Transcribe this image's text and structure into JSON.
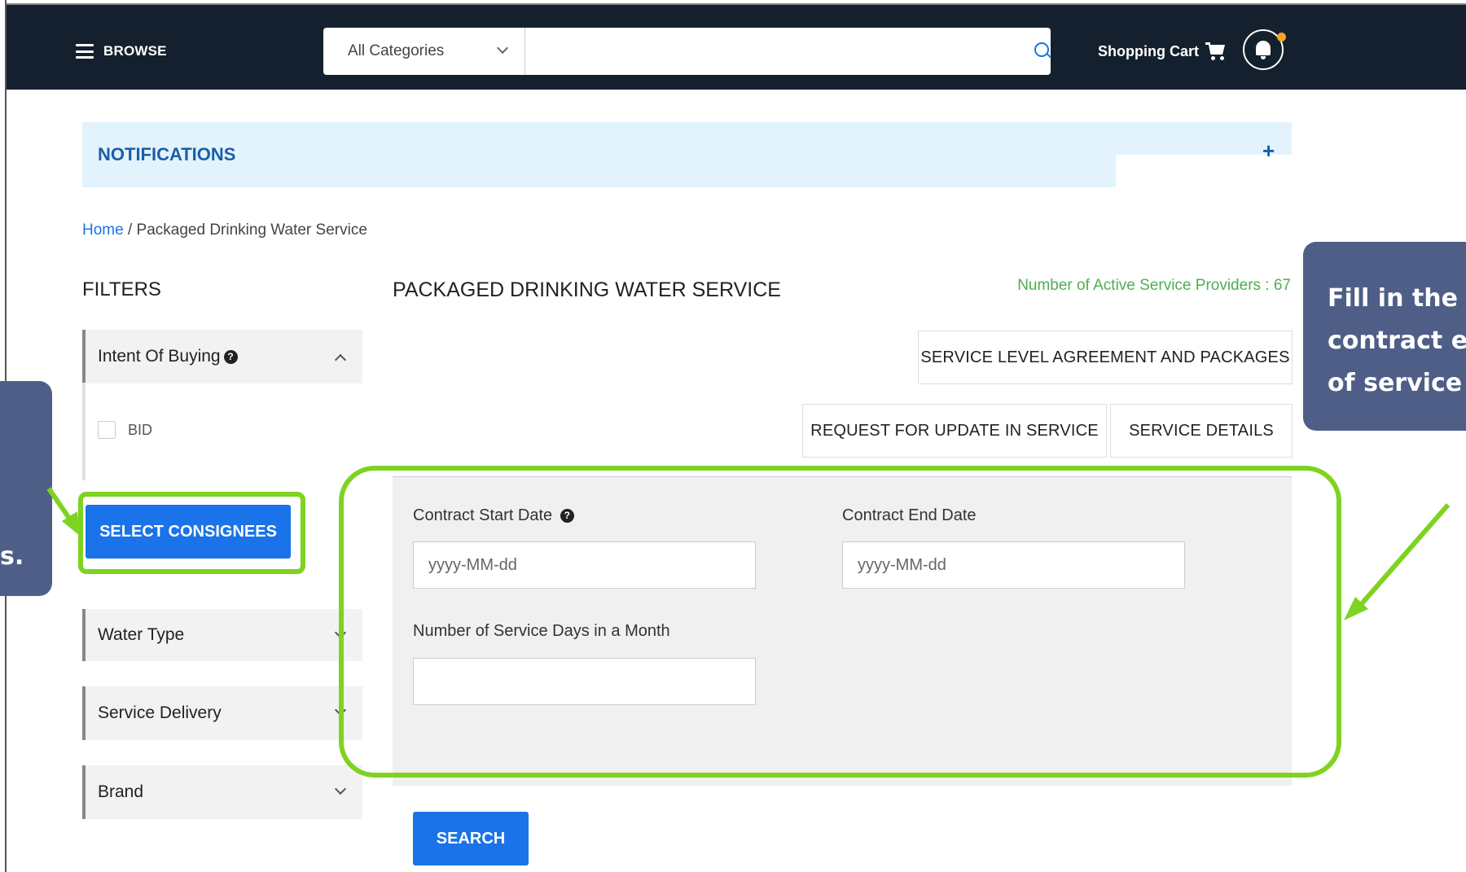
{
  "topbar": {
    "browse_label": "BROWSE",
    "category_selected": "All Categories",
    "search_placeholder": "",
    "cart_label": "Shopping Cart"
  },
  "notifications": {
    "title": "NOTIFICATIONS",
    "expand_symbol": "+"
  },
  "breadcrumb": {
    "home": "Home",
    "separator": "/",
    "current": "Packaged Drinking Water Service"
  },
  "filters": {
    "title": "FILTERS",
    "intent": {
      "label": "Intent Of Buying",
      "help": "?",
      "options": [
        {
          "label": "BID",
          "checked": false
        }
      ]
    },
    "select_consignees": "SELECT CONSIGNEES",
    "water_type": "Water Type",
    "service_delivery": "Service Delivery",
    "brand": "Brand"
  },
  "main": {
    "title": "PACKAGED DRINKING WATER SERVICE",
    "providers_text": "Number of Active Service Providers : 67",
    "sla_button": "SERVICE LEVEL AGREEMENT AND PACKAGES",
    "request_update_button": "REQUEST FOR UPDATE IN SERVICE",
    "service_details_button": "SERVICE DETAILS",
    "form": {
      "start_label": "Contract Start Date",
      "start_help": "?",
      "start_placeholder": "yyyy-MM-dd",
      "end_label": "Contract End Date",
      "end_placeholder": "yyyy-MM-dd",
      "days_label": "Number of Service Days in a Month",
      "days_value": ""
    },
    "search_button": "SEARCH"
  },
  "annotations": {
    "left_callout_fragment": "s.",
    "right_callout_lines": [
      "Fill in the",
      "contract e",
      "of service"
    ]
  },
  "colors": {
    "accent": "#1a73e8",
    "topbar": "#14202d",
    "highlight": "#7ed321",
    "callout": "#4e5e87",
    "providers": "#4caf50"
  }
}
